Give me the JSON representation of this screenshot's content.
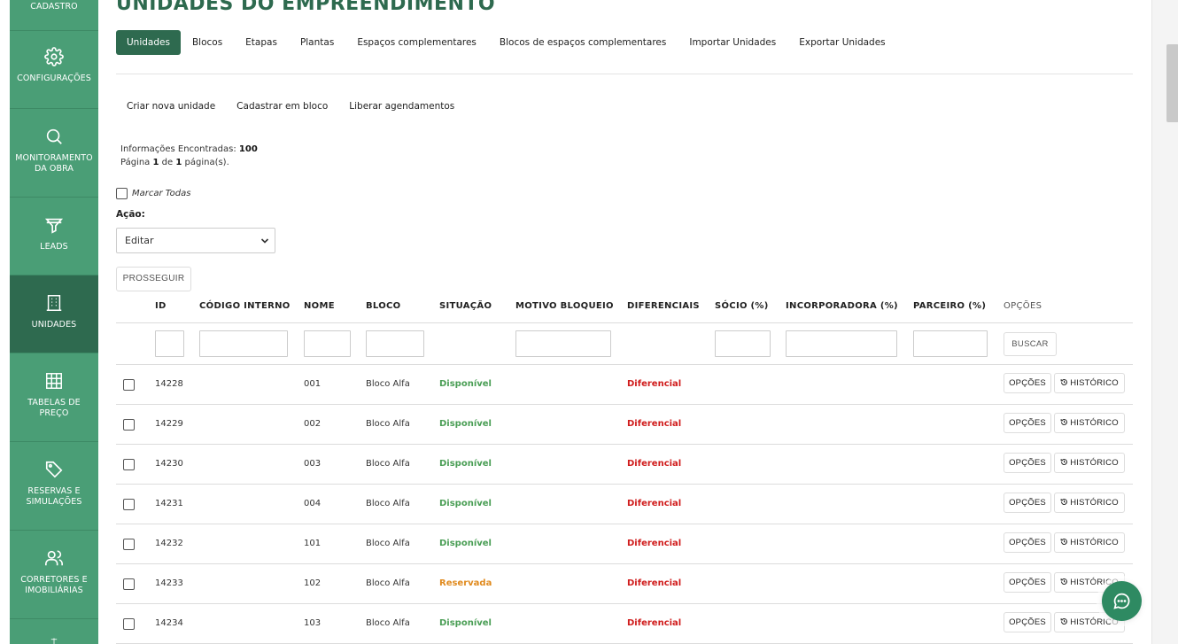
{
  "sidebar": {
    "items": [
      {
        "label": "CADASTRO",
        "icon": "cadastro-icon"
      },
      {
        "label": "CONFIGURAÇÕES",
        "icon": "gear-icon"
      },
      {
        "label": "MONITORAMENTO DA OBRA",
        "icon": "search-icon"
      },
      {
        "label": "LEADS",
        "icon": "funnel-icon"
      },
      {
        "label": "UNIDADES",
        "icon": "building-icon",
        "active": true
      },
      {
        "label": "TABELAS DE PREÇO",
        "icon": "grid-icon"
      },
      {
        "label": "RESERVAS E SIMULAÇÕES",
        "icon": "tag-icon"
      },
      {
        "label": "CORRETORES E IMOBILIÁRIAS",
        "icon": "users-icon"
      },
      {
        "label": "",
        "icon": "scale-icon"
      }
    ]
  },
  "page": {
    "title": "UNIDADES DO EMPREENDIMENTO"
  },
  "tabs": [
    {
      "label": "Unidades",
      "active": true
    },
    {
      "label": "Blocos"
    },
    {
      "label": "Etapas"
    },
    {
      "label": "Plantas"
    },
    {
      "label": "Espaços complementares"
    },
    {
      "label": "Blocos de espaços complementares"
    },
    {
      "label": "Importar Unidades"
    },
    {
      "label": "Exportar Unidades"
    }
  ],
  "subactions": [
    "Criar nova unidade",
    "Cadastrar em bloco",
    "Liberar agendamentos"
  ],
  "info": {
    "found_label": "Informações Encontradas:",
    "found_count": "100",
    "page_prefix": "Página",
    "page_current": "1",
    "page_of": "de",
    "page_total": "1",
    "page_suffix": "página(s)."
  },
  "mark_all_label": "Marcar Todas",
  "acao": {
    "label": "Ação:",
    "selected": "Editar"
  },
  "prosseguir_label": "PROSSEGUIR",
  "table": {
    "headers": {
      "id": "ID",
      "codigo": "CÓDIGO INTERNO",
      "nome": "NOME",
      "bloco": "BLOCO",
      "situacao": "SITUAÇÃO",
      "motivo": "MOTIVO BLOQUEIO",
      "diferenciais": "DIFERENCIAIS",
      "socio": "SÓCIO (%)",
      "incorporadora": "INCORPORADORA (%)",
      "parceiro": "PARCEIRO (%)",
      "opcoes": "OPÇÕES"
    },
    "buscar_label": "BUSCAR",
    "opcoes_btn": "OPÇÕES",
    "historico_btn": "HISTÓRICO",
    "rows": [
      {
        "id": "14228",
        "nome": "001",
        "bloco": "Bloco Alfa",
        "situacao": "Disponível",
        "status": "disponivel",
        "diferencial": "Diferencial"
      },
      {
        "id": "14229",
        "nome": "002",
        "bloco": "Bloco Alfa",
        "situacao": "Disponível",
        "status": "disponivel",
        "diferencial": "Diferencial"
      },
      {
        "id": "14230",
        "nome": "003",
        "bloco": "Bloco Alfa",
        "situacao": "Disponível",
        "status": "disponivel",
        "diferencial": "Diferencial"
      },
      {
        "id": "14231",
        "nome": "004",
        "bloco": "Bloco Alfa",
        "situacao": "Disponível",
        "status": "disponivel",
        "diferencial": "Diferencial"
      },
      {
        "id": "14232",
        "nome": "101",
        "bloco": "Bloco Alfa",
        "situacao": "Disponível",
        "status": "disponivel",
        "diferencial": "Diferencial"
      },
      {
        "id": "14233",
        "nome": "102",
        "bloco": "Bloco Alfa",
        "situacao": "Reservada",
        "status": "reservada",
        "diferencial": "Diferencial"
      },
      {
        "id": "14234",
        "nome": "103",
        "bloco": "Bloco Alfa",
        "situacao": "Disponível",
        "status": "disponivel",
        "diferencial": "Diferencial"
      }
    ]
  },
  "colors": {
    "sidebar": "#4a9e76",
    "sidebar_active": "#2e6a4f",
    "accent": "#2e6a4f",
    "disponivel": "#4a9e55",
    "reservada": "#e08a1e",
    "diferencial": "#d01c1c"
  }
}
